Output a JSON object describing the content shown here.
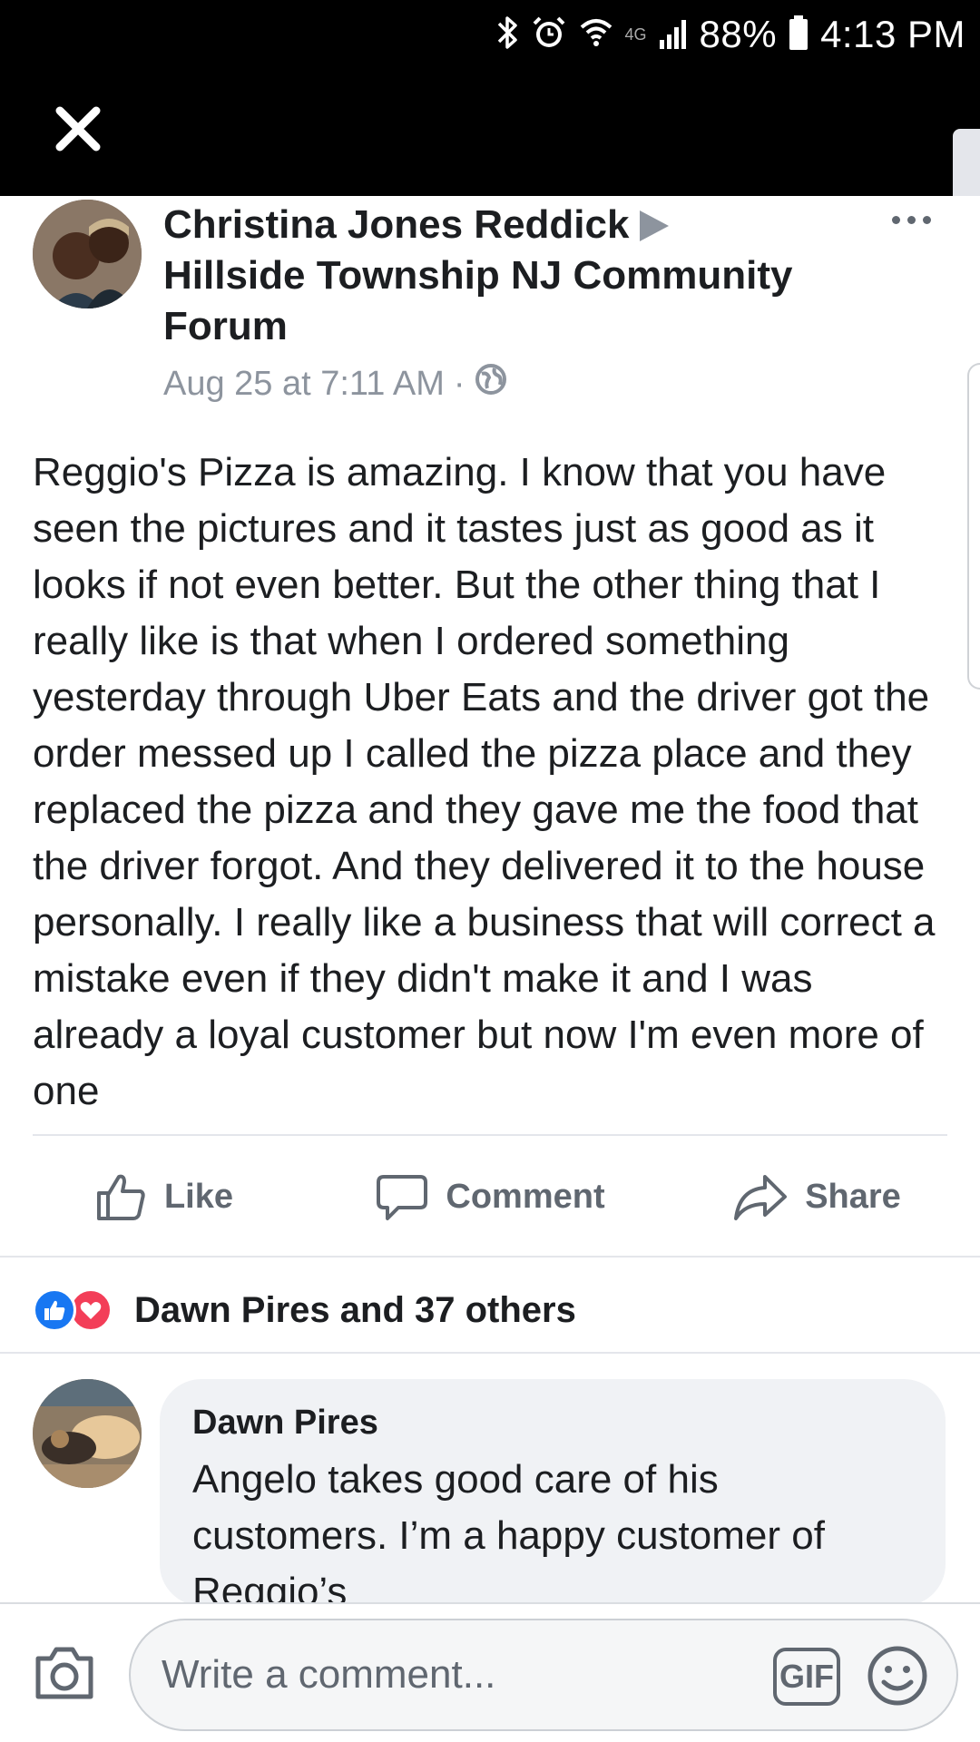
{
  "status_bar": {
    "network": "4G",
    "battery": "88%",
    "time": "4:13 PM",
    "icons": [
      "bluetooth-icon",
      "alarm-icon",
      "wifi-icon",
      "signal-icon",
      "battery-icon"
    ]
  },
  "post": {
    "author": "Christina Jones Reddick",
    "group": "Hillside Township NJ Community Forum",
    "timestamp": "Aug 25 at 7:11 AM",
    "separator": "·",
    "privacy_icon": "globe-icon",
    "text": "Reggio's Pizza is amazing. I know that you have seen the pictures and it tastes just as good as it looks if not even better. But the other thing that I really like is that when I ordered something yesterday through Uber Eats and the driver got the order messed up I called the pizza place and they replaced the pizza and they gave me the food that the driver forgot. And they delivered it to the house personally. I really like a business that will correct a mistake even if they didn't make it and I was already a loyal customer but now I'm even more of one"
  },
  "actions": {
    "like": "Like",
    "comment": "Comment",
    "share": "Share"
  },
  "reactions": {
    "summary": "Dawn Pires and 37 others"
  },
  "comment": {
    "author": "Dawn Pires",
    "text": "Angelo takes good care of his customers. I’m a happy customer of Reggio’s"
  },
  "composer": {
    "placeholder": "Write a comment...",
    "gif_label": "GIF"
  },
  "colors": {
    "header_bg": "#000000",
    "text": "#1c1e21",
    "secondary": "#606770",
    "meta": "#8d949e",
    "like_blue": "#1877f2",
    "love_red": "#f33e58",
    "bubble": "#f0f2f5"
  }
}
